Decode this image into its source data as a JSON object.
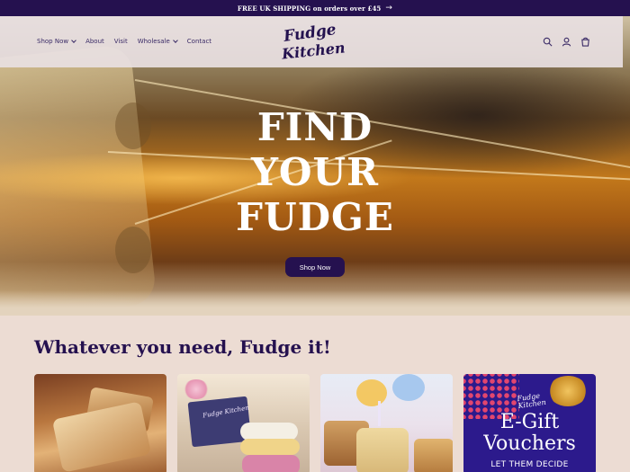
{
  "announcement": {
    "text": "FREE UK SHIPPING on orders over £45",
    "arrow": "→"
  },
  "header": {
    "nav": [
      {
        "label": "Shop Now",
        "has_dropdown": true
      },
      {
        "label": "About",
        "has_dropdown": false
      },
      {
        "label": "Visit",
        "has_dropdown": false
      },
      {
        "label": "Wholesale",
        "has_dropdown": true
      },
      {
        "label": "Contact",
        "has_dropdown": false
      }
    ],
    "logo": {
      "line1": "Fudge",
      "line2": "Kitchen"
    },
    "icons": [
      "search-icon",
      "account-icon",
      "cart-icon"
    ]
  },
  "hero": {
    "title_lines": [
      "FIND",
      "YOUR",
      "FUDGE"
    ],
    "button": "Shop Now"
  },
  "section": {
    "title": "Whatever you need, Fudge it!",
    "cards": [
      {
        "image": "fudge-slices-image"
      },
      {
        "image": "fudge-gift-box-image",
        "box_label": "Fudge Kitchen"
      },
      {
        "image": "fudge-cake-image"
      },
      {
        "image": "e-gift-vouchers-image",
        "mini_logo_1": "Fudge",
        "mini_logo_2": "Kitchen",
        "line1": "E-Gift",
        "line2": "Vouchers",
        "tagline": "LET THEM DECIDE"
      }
    ]
  },
  "colors": {
    "brand": "#25114f",
    "page_bg": "#ecdcd3",
    "voucher_bg": "#2c1a8c",
    "text_light": "#ffffff"
  }
}
